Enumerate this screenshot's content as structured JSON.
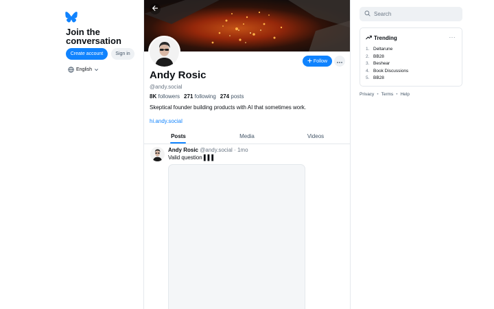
{
  "left": {
    "logo": "bluesky-butterfly-icon",
    "join_title": "Join the conversation",
    "create_account": "Create account",
    "sign_in": "Sign in",
    "language": "English"
  },
  "profile": {
    "back_icon": "arrow-left-icon",
    "name": "Andy Rosic",
    "handle": "@andy.social",
    "followers_count": "8K",
    "followers_label": "followers",
    "following_count": "271",
    "following_label": "following",
    "posts_count": "274",
    "posts_label": "posts",
    "bio": "Skeptical founder building products with AI that sometimes work.",
    "link": "hi.andy.social",
    "follow_label": "Follow"
  },
  "tabs": [
    {
      "label": "Posts",
      "active": true
    },
    {
      "label": "Media",
      "active": false
    },
    {
      "label": "Videos",
      "active": false
    }
  ],
  "post": {
    "author": "Andy Rosic",
    "handle": "@andy.social",
    "separator": "·",
    "time": "1mo",
    "text": "Valid question ▌▌▌"
  },
  "right": {
    "search_placeholder": "Search",
    "trending_title": "Trending",
    "trending": [
      {
        "num": "1.",
        "label": "Deltarune"
      },
      {
        "num": "2.",
        "label": "BB28"
      },
      {
        "num": "3.",
        "label": "Beshear"
      },
      {
        "num": "4.",
        "label": "Book Discussions"
      },
      {
        "num": "5.",
        "label": "BB28"
      }
    ],
    "footer": [
      "Privacy",
      "Terms",
      "Help"
    ],
    "footer_sep": "•"
  },
  "colors": {
    "accent": "#1083fe",
    "border": "#e4e8ec",
    "muted": "#6b7785"
  }
}
